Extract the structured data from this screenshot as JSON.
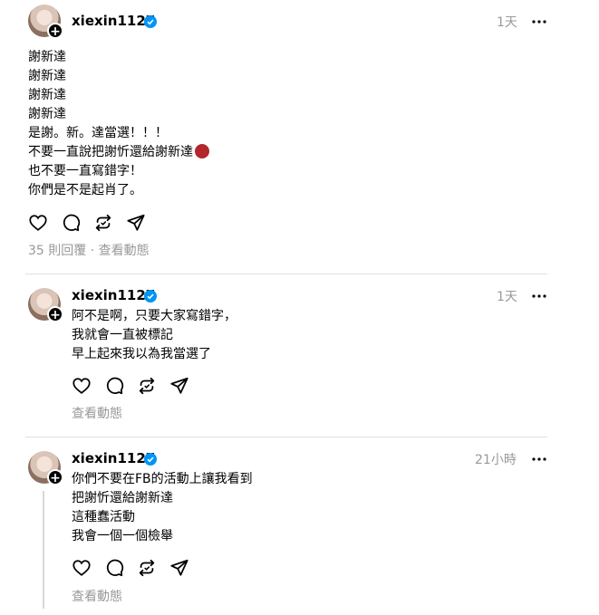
{
  "posts": [
    {
      "username": "xiexin1127",
      "time": "1天",
      "lines": [
        "謝新達",
        "謝新達",
        "謝新達",
        "謝新達",
        "是謝。新。達當選！！！",
        "不要一直說把謝忻還給謝新達",
        "也不要一直寫錯字！",
        "你們是不是起肖了。"
      ],
      "emoji": "angry-devil-emoji",
      "meta": "35 則回覆 · 查看動態"
    },
    {
      "username": "xiexin1127",
      "time": "1天",
      "lines": [
        "阿不是啊，只要大家寫錯字，",
        "我就會一直被標記",
        "早上起來我以為我當選了"
      ],
      "meta": "查看動態"
    },
    {
      "username": "xiexin1127",
      "time": "21小時",
      "lines": [
        "你們不要在FB的活動上讓我看到",
        "把謝忻還給謝新達",
        "這種蠢活動",
        "我會一個一個檢舉"
      ],
      "meta": "查看動態"
    }
  ],
  "icons": {
    "like": "heart-icon",
    "reply": "comment-icon",
    "repost": "repost-icon",
    "share": "share-icon",
    "more": "more-icon",
    "verified": "verified-badge-icon"
  },
  "colors": {
    "verified": "#0095f6",
    "muted": "#999999",
    "divider": "#e0e0e0"
  }
}
